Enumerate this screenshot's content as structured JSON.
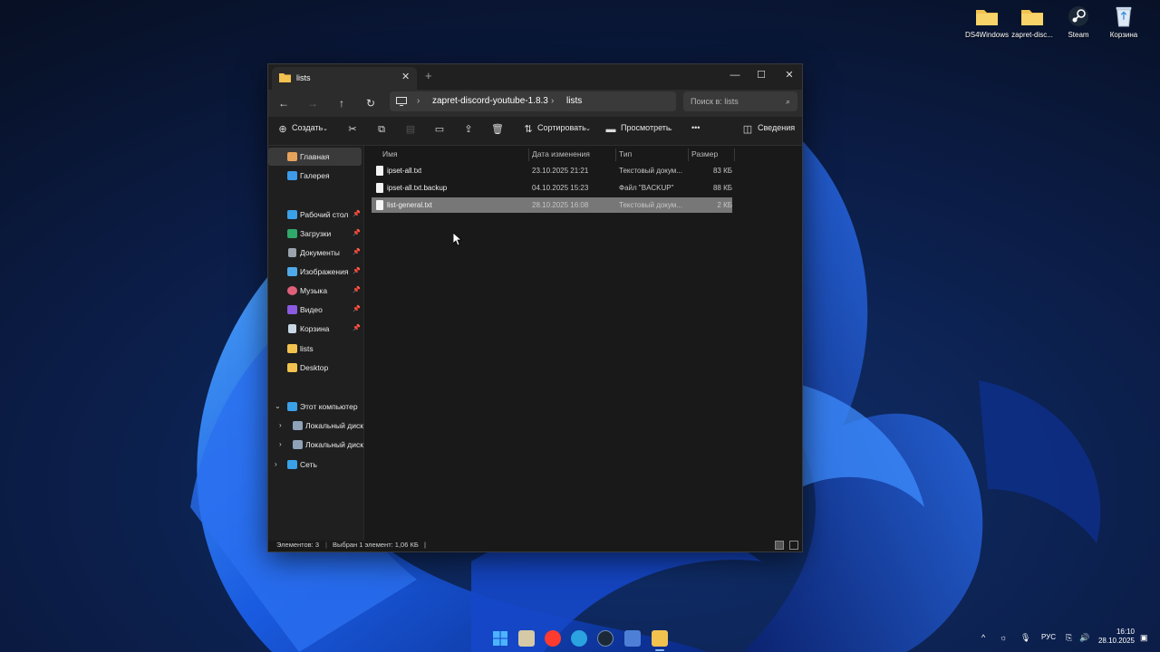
{
  "desktop": {
    "icons": [
      {
        "label": "DS4Windows",
        "icon": "folder-icon"
      },
      {
        "label": "zapret-disc...",
        "icon": "folder-icon"
      },
      {
        "label": "Steam",
        "icon": "steam-icon"
      },
      {
        "label": "Корзина",
        "icon": "recycle-bin-icon"
      }
    ]
  },
  "window": {
    "tab_title": "lists",
    "tab_close": "✕",
    "new_tab": "+",
    "controls": {
      "minimize": "—",
      "maximize": "☐",
      "close": "✕"
    },
    "address": {
      "root_icon": "pc-icon",
      "segments": [
        "zapret-discord-youtube-1.8.3",
        "lists"
      ]
    },
    "search_placeholder": "Поиск в: lists",
    "toolbar": {
      "create": "Создать",
      "sort": "Сортировать",
      "view": "Просмотреть",
      "more": "•••",
      "details": "Сведения"
    },
    "sidebar": {
      "items": [
        {
          "label": "Главная",
          "icon": "home-icon",
          "selected": true
        },
        {
          "label": "Галерея",
          "icon": "gallery-icon"
        },
        {
          "label": "Рабочий стол",
          "icon": "desktop-icon",
          "pinned": true
        },
        {
          "label": "Загрузки",
          "icon": "downloads-icon",
          "pinned": true
        },
        {
          "label": "Документы",
          "icon": "documents-icon",
          "pinned": true
        },
        {
          "label": "Изображения",
          "icon": "pictures-icon",
          "pinned": true
        },
        {
          "label": "Музыка",
          "icon": "music-icon",
          "pinned": true
        },
        {
          "label": "Видео",
          "icon": "videos-icon",
          "pinned": true
        },
        {
          "label": "Корзина",
          "icon": "recycle-bin-icon",
          "pinned": true
        },
        {
          "label": "lists",
          "icon": "folder-icon"
        },
        {
          "label": "Desktop",
          "icon": "folder-icon"
        },
        {
          "label": "Этот компьютер",
          "icon": "pc-icon",
          "expanded": true
        },
        {
          "label": "Локальный диск",
          "icon": "drive-icon"
        },
        {
          "label": "Локальный диск",
          "icon": "drive-icon"
        },
        {
          "label": "Сеть",
          "icon": "network-icon"
        }
      ]
    },
    "columns": {
      "name": "Имя",
      "modified": "Дата изменения",
      "type": "Тип",
      "size": "Размер"
    },
    "files": [
      {
        "name": "ipset-all.txt",
        "modified": "23.10.2025 21:21",
        "type": "Текстовый докум...",
        "size": "83 КБ",
        "selected": false
      },
      {
        "name": "ipset-all.txt.backup",
        "modified": "04.10.2025 15:23",
        "type": "Файл \"BACKUP\"",
        "size": "88 КБ",
        "selected": false
      },
      {
        "name": "list-general.txt",
        "modified": "28.10.2025 16:08",
        "type": "Текстовый докум...",
        "size": "2 КБ",
        "selected": true
      }
    ],
    "status": {
      "count": "Элементов: 3",
      "selected": "Выбран 1 элемент: 1,06 КБ"
    }
  },
  "taskbar": {
    "language": "РУС",
    "time": "16:10",
    "date": "28.10.2025"
  },
  "colors": {
    "accent": "#1a6ef5",
    "window_bg": "#191919",
    "selection": "#777777"
  }
}
